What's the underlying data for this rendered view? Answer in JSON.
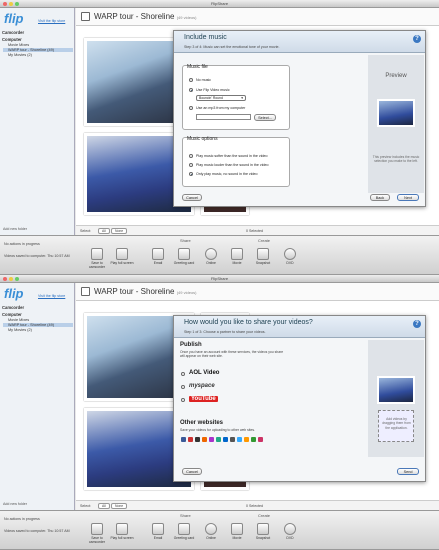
{
  "app": {
    "window_title": "FlipShare",
    "logo": "flip",
    "feedback_link": "Visit the flip store",
    "sidebar": {
      "camcorder_label": "Camcorder",
      "computer_label": "Computer",
      "items": [
        "Movie Mixes",
        "WARP tour - Shoreline (49)",
        "My Movies (2)"
      ],
      "add_folder": "Add new folder"
    },
    "main": {
      "title": "WARP tour - Shoreline",
      "count": "(49 videos)",
      "footer_select": "Select:",
      "footer_all": "All",
      "footer_none": "None",
      "footer_selected": "0 Selected"
    },
    "bottom": {
      "status_1": "No actions in progress",
      "status_2": "Videos saved to computer. Thu 10:57 AM",
      "share_group": "Share",
      "create_group": "Create",
      "tools": [
        {
          "label": "Save to camcorder"
        },
        {
          "label": "Play full screen"
        },
        {
          "label": "Email"
        },
        {
          "label": "Greeting card"
        },
        {
          "label": "Online"
        },
        {
          "label": "Movie"
        },
        {
          "label": "Snapshot"
        },
        {
          "label": "DVD"
        }
      ]
    }
  },
  "dialog1": {
    "title": "Include music",
    "subtitle": "Step 3 of 4: Music can set the emotional tone of your movie.",
    "music_file_label": "Music file",
    "options": [
      "No music",
      "Use Flip Video music",
      "Use an mp3 from my computer"
    ],
    "selected_track": "Bouncin' Round",
    "select_button": "Select...",
    "music_options_label": "Music options",
    "music_options": [
      "Play music softer than the sound in the video",
      "Play music louder than the sound in the video",
      "Only play music, no sound in the video"
    ],
    "preview_title": "Preview",
    "preview_text": "This preview includes the music selection you make to the left.",
    "cancel": "Cancel",
    "back": "Back",
    "next": "Next"
  },
  "dialog2": {
    "title": "How would you like to share your videos?",
    "subtitle": "Step 1 of 3: Choose a partner to share your videos.",
    "publish_label": "Publish",
    "publish_text": "Once you have an account with these services, the videos you share will appear on their web site.",
    "services": [
      "AOL Video",
      "myspace",
      "YouTube"
    ],
    "other_label": "Other websites",
    "other_text": "Save your videos for uploading to other web sites.",
    "drop_text": "Add videos by dragging them from the application.",
    "cancel": "Cancel",
    "send": "Send"
  },
  "colors": {
    "accent": "#3b8fd6",
    "dialog_title": "#245588",
    "selection": "#b9cfe8"
  }
}
